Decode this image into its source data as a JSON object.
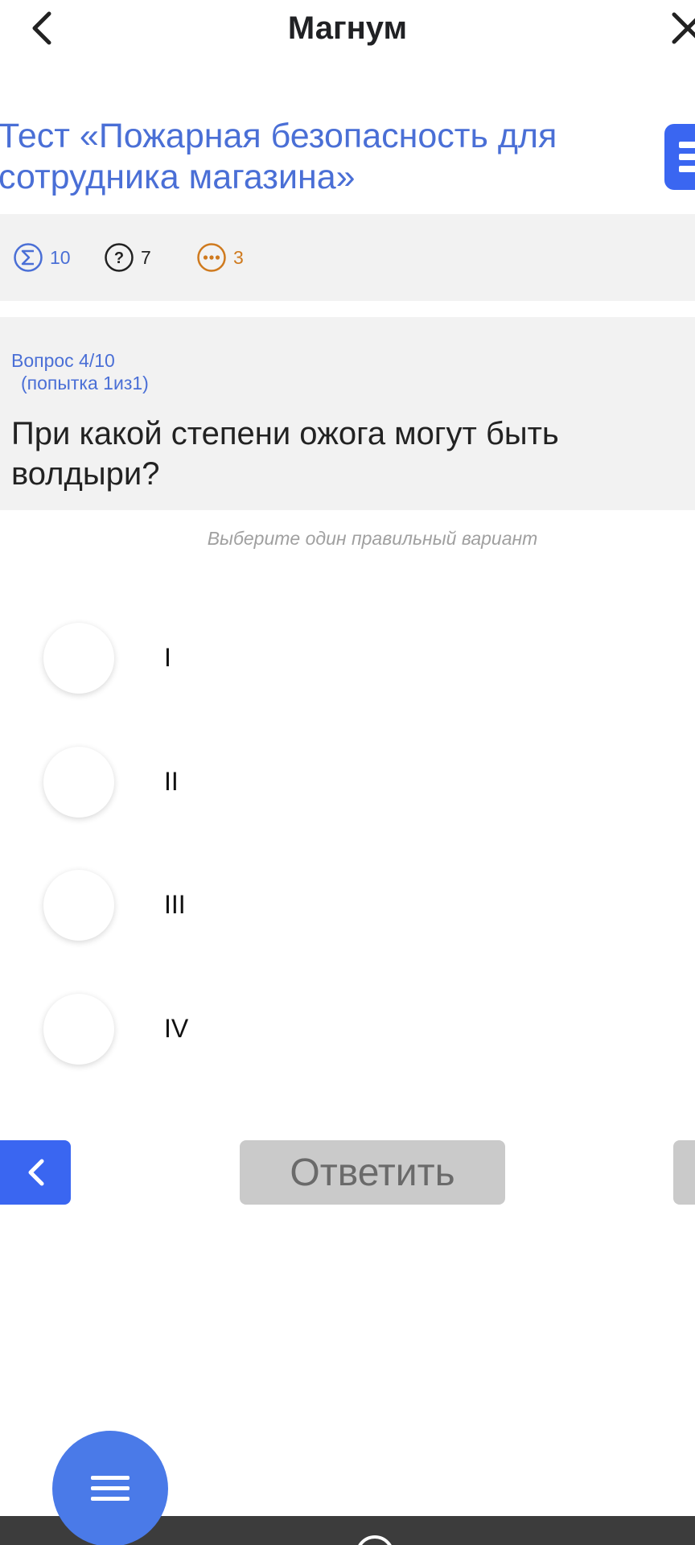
{
  "header": {
    "title": "Магнум",
    "back_icon": "chevron-left-icon",
    "close_icon": "close-icon"
  },
  "test": {
    "title": "Тест «Пожарная безопасность для сотрудника магазина»"
  },
  "stats": {
    "total": "10",
    "remaining": "7",
    "pending": "3"
  },
  "question": {
    "counter": "Вопрос 4/10",
    "attempt": "(попытка 1из1)",
    "text": "При какой степени ожога могут быть волдыри?"
  },
  "hint": "Выберите один правильный вариант",
  "options": [
    {
      "label": "I"
    },
    {
      "label": "II"
    },
    {
      "label": "III"
    },
    {
      "label": "IV"
    }
  ],
  "actions": {
    "answer_label": "Ответить"
  },
  "colors": {
    "accent": "#3a66f1",
    "title_blue": "#4a6fd6",
    "pending_orange": "#cf7a1e",
    "disabled_gray": "#cacaca"
  }
}
